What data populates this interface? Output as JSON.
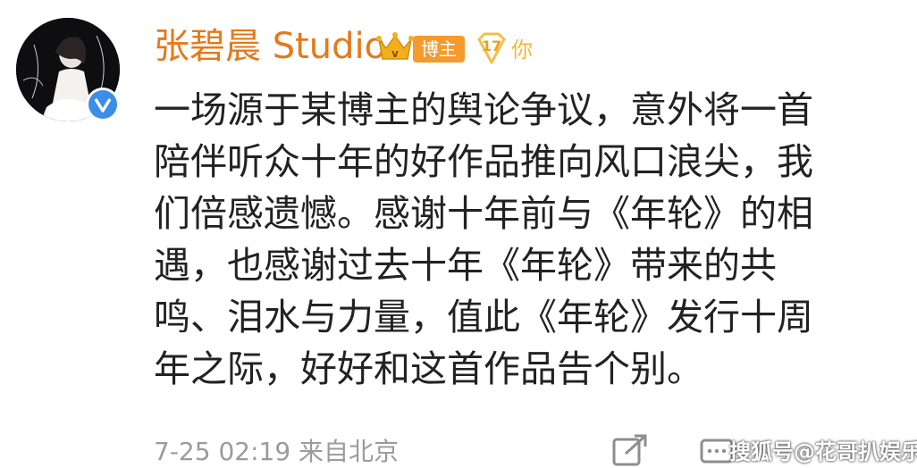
{
  "post": {
    "author": "张碧晨 Studio",
    "badge_blogger": "博主",
    "level": "17",
    "level_suffix": "你",
    "lines": [
      "一场源于某博主的舆论争议，意外将一首",
      "陪伴听众十年的好作品推向风口浪尖，我",
      "们倍感遗憾。感谢十年前与《年轮》的相",
      "遇，也感谢过去十年《年轮》带来的共",
      "鸣、泪水与力量，值此《年轮》发行十周",
      "年之际，好好和这首作品告个别。"
    ],
    "timestamp": "7-25 02:19  来自北京"
  },
  "watermark": "搜狐号@花哥扒娱乐",
  "icons": {
    "verified": "verified-v-icon",
    "crown": "crown-icon",
    "level": "diamond-level-icon",
    "share": "share-icon",
    "comment": "comment-icon"
  },
  "colors": {
    "author": "#e4791b",
    "blogger_badge": "#f59a2b",
    "verified": "#3b8ee8",
    "text": "#222222",
    "meta": "#9b9b9b"
  }
}
